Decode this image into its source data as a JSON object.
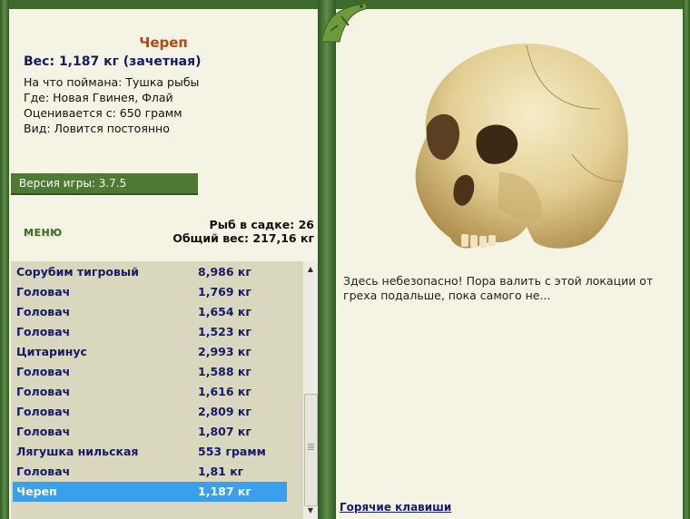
{
  "catch": {
    "title": "Череп",
    "weight": "Вес: 1,187 кг (зачетная)",
    "details": [
      "На что поймана: Тушка рыбы",
      "Где: Новая Гвинея, Флай",
      "Оценивается с: 650 грамм",
      "Вид: Ловится постоянно"
    ]
  },
  "version": "Версия игры: 3.7.5",
  "menu_label": "МЕНЮ",
  "stats": {
    "fish_in_keepnet": "Рыб в садке: 26",
    "total_weight": "Общий вес: 217,16 кг"
  },
  "fish_list": [
    {
      "name": "Сорубим тигровый",
      "weight": "8,986 кг"
    },
    {
      "name": "Головач",
      "weight": "1,769 кг"
    },
    {
      "name": "Головач",
      "weight": "1,654 кг"
    },
    {
      "name": "Головач",
      "weight": "1,523 кг"
    },
    {
      "name": "Цитаринус",
      "weight": "2,993 кг"
    },
    {
      "name": "Головач",
      "weight": "1,588 кг"
    },
    {
      "name": "Головач",
      "weight": "1,616 кг"
    },
    {
      "name": "Головач",
      "weight": "2,809 кг"
    },
    {
      "name": "Головач",
      "weight": "1,807 кг"
    },
    {
      "name": "Лягушка нильская",
      "weight": "553 грамм"
    },
    {
      "name": "Головач",
      "weight": "1,81 кг"
    },
    {
      "name": "Череп",
      "weight": "1,187 кг",
      "selected": true
    }
  ],
  "message": "Здесь небезопасно! Пора валить с этой локации от греха подальше, пока самого не...",
  "hotkeys_label": "Горячие клавиши",
  "colors": {
    "frame_green": "#3e6a2c",
    "panel_bg": "#f5f4e4",
    "title_orange": "#b14a0f",
    "text_navy": "#151a6a",
    "selection_blue": "#3aa0ee"
  }
}
